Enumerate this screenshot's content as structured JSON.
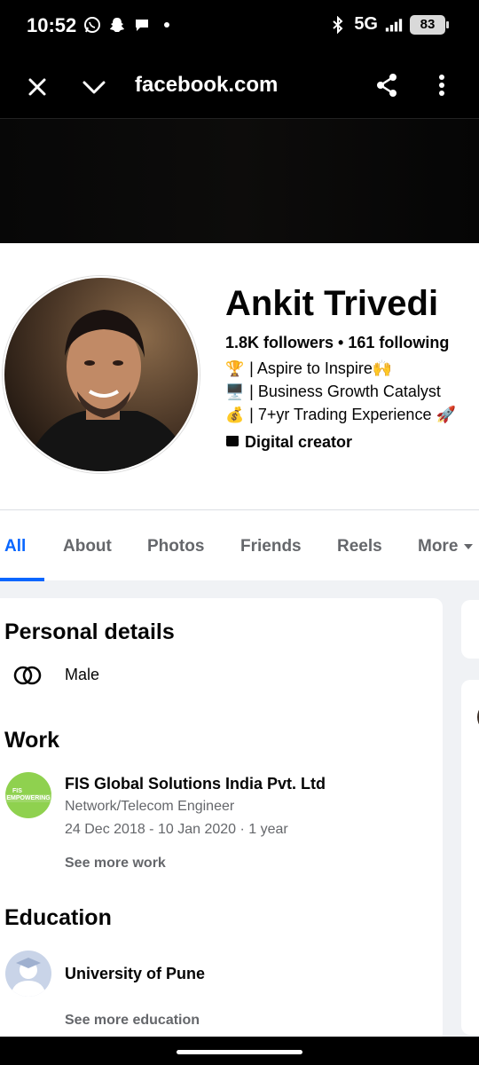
{
  "status_bar": {
    "time": "10:52",
    "left_icons": [
      "whatsapp-icon",
      "snapchat-icon",
      "chat-bubble-icon",
      "dot-icon"
    ],
    "network": "5G",
    "battery": "83"
  },
  "browser": {
    "url": "facebook.com",
    "icons": [
      "close-icon",
      "chevron-down-icon",
      "share-icon",
      "more-vertical-icon"
    ]
  },
  "profile": {
    "name": "Ankit Trivedi",
    "stats": "1.8K followers • 161 following",
    "bio": [
      {
        "emoji": "🏆",
        "text": "| Aspire to Inspire🙌"
      },
      {
        "emoji": "🖥️",
        "text": "| Business Growth Catalyst"
      },
      {
        "emoji": "💰",
        "text": "| 7+yr Trading Experience 🚀"
      }
    ],
    "category": "Digital creator"
  },
  "tabs": [
    {
      "label": "All",
      "active": true
    },
    {
      "label": "About",
      "active": false
    },
    {
      "label": "Photos",
      "active": false
    },
    {
      "label": "Friends",
      "active": false
    },
    {
      "label": "Reels",
      "active": false
    },
    {
      "label": "More",
      "active": false
    }
  ],
  "personal_details": {
    "title": "Personal details",
    "gender": "Male"
  },
  "work": {
    "title": "Work",
    "company": "FIS Global Solutions India Pvt. Ltd",
    "role": "Network/Telecom Engineer",
    "dates": "24 Dec 2018 - 10 Jan 2020 · 1 year",
    "see_more": "See more work",
    "logo_text_top": "FIS",
    "logo_text_mid": "EMPOWERING"
  },
  "education": {
    "title": "Education",
    "school": "University of Pune",
    "see_more": "See more education"
  },
  "colors": {
    "accent": "#0866ff",
    "secondary_text": "#65676b",
    "page_bg": "#f0f2f5"
  }
}
